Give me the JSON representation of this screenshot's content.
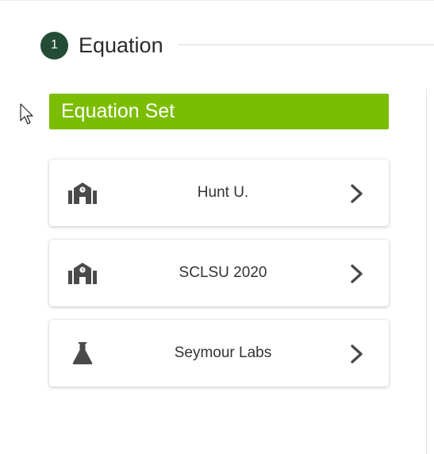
{
  "step": {
    "number": "1",
    "title": "Equation"
  },
  "section": {
    "title": "Equation Set"
  },
  "items": [
    {
      "label": "Hunt U.",
      "icon": "school-icon"
    },
    {
      "label": "SCLSU 2020",
      "icon": "school-icon"
    },
    {
      "label": "Seymour Labs",
      "icon": "flask-icon"
    }
  ],
  "colors": {
    "accent_green": "#7bbd00",
    "badge_dark_green": "#244b36",
    "icon_gray": "#4a4a4a"
  }
}
